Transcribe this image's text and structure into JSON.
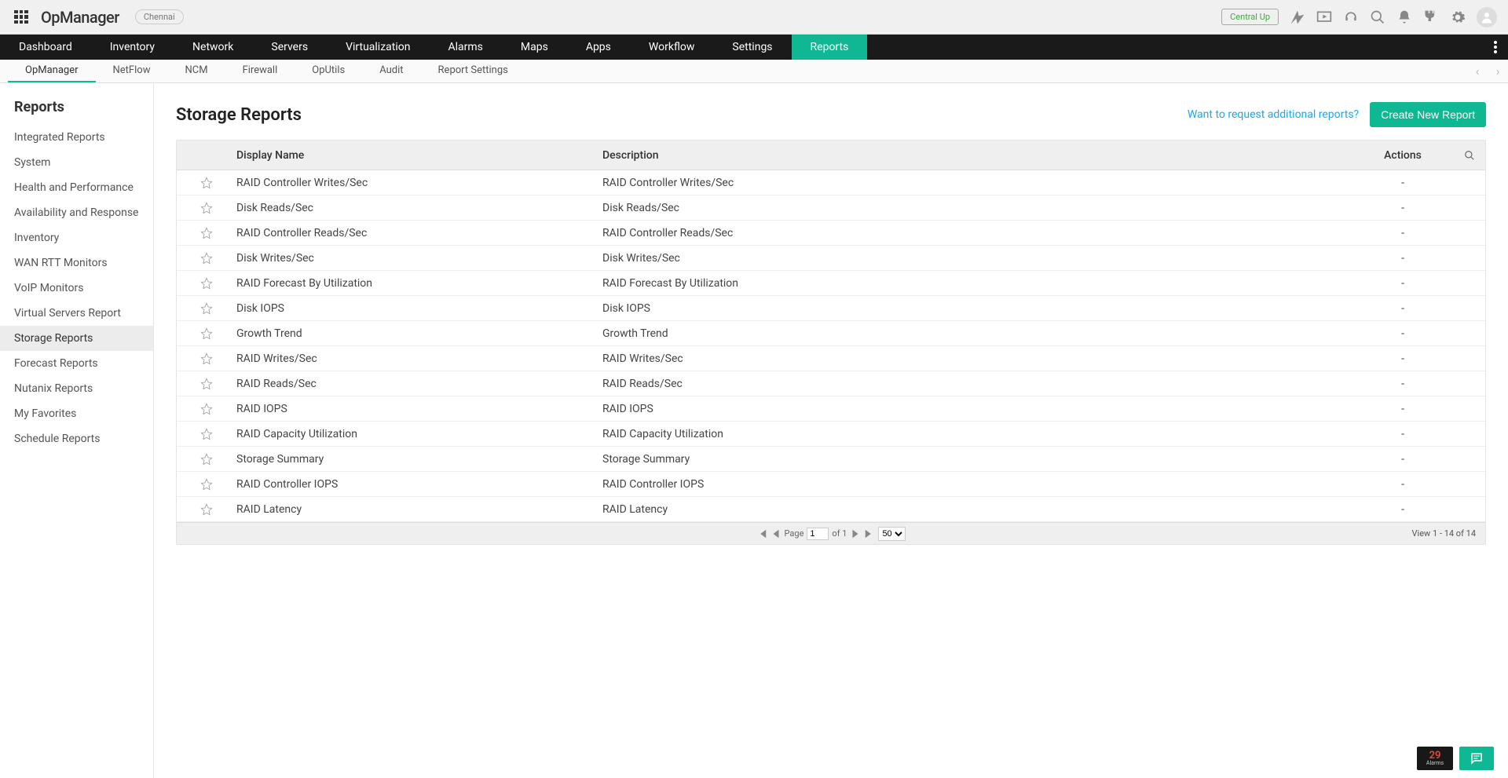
{
  "header": {
    "app_name": "OpManager",
    "location": "Chennai",
    "central_status": "Central Up"
  },
  "nav": {
    "items": [
      "Dashboard",
      "Inventory",
      "Network",
      "Servers",
      "Virtualization",
      "Alarms",
      "Maps",
      "Apps",
      "Workflow",
      "Settings",
      "Reports"
    ],
    "active": "Reports"
  },
  "subnav": {
    "items": [
      "OpManager",
      "NetFlow",
      "NCM",
      "Firewall",
      "OpUtils",
      "Audit",
      "Report Settings"
    ],
    "active": "OpManager"
  },
  "sidebar": {
    "title": "Reports",
    "items": [
      "Integrated Reports",
      "System",
      "Health and Performance",
      "Availability and Response",
      "Inventory",
      "WAN RTT Monitors",
      "VoIP Monitors",
      "Virtual Servers Report",
      "Storage Reports",
      "Forecast Reports",
      "Nutanix Reports",
      "My Favorites",
      "Schedule Reports"
    ],
    "active": "Storage Reports"
  },
  "page": {
    "title": "Storage Reports",
    "request_link": "Want to request additional reports?",
    "create_button": "Create New Report"
  },
  "table": {
    "columns": {
      "name": "Display Name",
      "desc": "Description",
      "actions": "Actions"
    },
    "rows": [
      {
        "name": "RAID Controller Writes/Sec",
        "desc": "RAID Controller Writes/Sec",
        "actions": "-"
      },
      {
        "name": "Disk Reads/Sec",
        "desc": "Disk Reads/Sec",
        "actions": "-"
      },
      {
        "name": "RAID Controller Reads/Sec",
        "desc": "RAID Controller Reads/Sec",
        "actions": "-"
      },
      {
        "name": "Disk Writes/Sec",
        "desc": "Disk Writes/Sec",
        "actions": "-"
      },
      {
        "name": "RAID Forecast By Utilization",
        "desc": "RAID Forecast By Utilization",
        "actions": "-"
      },
      {
        "name": "Disk IOPS",
        "desc": "Disk IOPS",
        "actions": "-"
      },
      {
        "name": "Growth Trend",
        "desc": "Growth Trend",
        "actions": "-"
      },
      {
        "name": "RAID Writes/Sec",
        "desc": "RAID Writes/Sec",
        "actions": "-"
      },
      {
        "name": "RAID Reads/Sec",
        "desc": "RAID Reads/Sec",
        "actions": "-"
      },
      {
        "name": "RAID IOPS",
        "desc": "RAID IOPS",
        "actions": "-"
      },
      {
        "name": "RAID Capacity Utilization",
        "desc": "RAID Capacity Utilization",
        "actions": "-"
      },
      {
        "name": "Storage Summary",
        "desc": "Storage Summary",
        "actions": "-"
      },
      {
        "name": "RAID Controller IOPS",
        "desc": "RAID Controller IOPS",
        "actions": "-"
      },
      {
        "name": "RAID Latency",
        "desc": "RAID Latency",
        "actions": "-"
      }
    ]
  },
  "pager": {
    "page_label": "Page",
    "page_value": "1",
    "of_label": "of 1",
    "page_size": "50",
    "view_text": "View 1 - 14 of 14"
  },
  "bottom": {
    "alarm_count": "29",
    "alarm_label": "Alarms"
  }
}
